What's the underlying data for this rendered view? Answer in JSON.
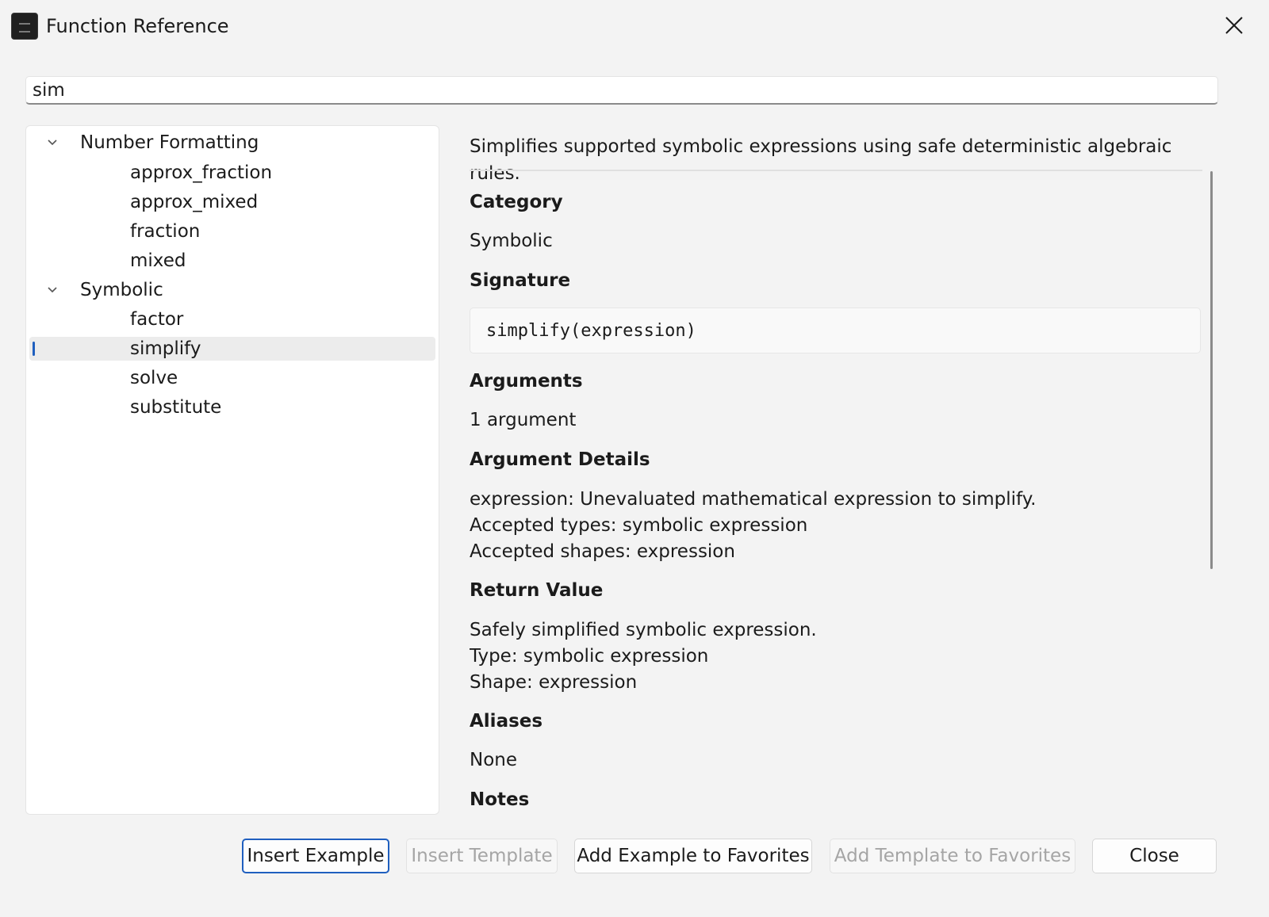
{
  "window": {
    "title": "Function Reference",
    "icon": "calculator-app-icon",
    "close_icon": "close-icon"
  },
  "search": {
    "value": "sim"
  },
  "tree": {
    "groups": [
      {
        "label": "Number Formatting",
        "expanded": true,
        "items": [
          "approx_fraction",
          "approx_mixed",
          "fraction",
          "mixed"
        ]
      },
      {
        "label": "Symbolic",
        "expanded": true,
        "items": [
          "factor",
          "simplify",
          "solve",
          "substitute"
        ]
      }
    ],
    "selected": "simplify",
    "accent_color": "#1f5fbf"
  },
  "details": {
    "description": "Simplifies supported symbolic expressions using safe deterministic algebraic rules.",
    "category_heading": "Category",
    "category": "Symbolic",
    "signature_heading": "Signature",
    "signature": "simplify(expression)",
    "arguments_heading": "Arguments",
    "arguments": "1 argument",
    "argument_details_heading": "Argument Details",
    "argument_details": [
      "expression: Unevaluated mathematical expression to simplify.",
      "Accepted types: symbolic expression",
      "Accepted shapes: expression"
    ],
    "return_heading": "Return Value",
    "return_value": [
      "Safely simplified symbolic expression.",
      "Type: symbolic expression",
      "Shape: expression"
    ],
    "aliases_heading": "Aliases",
    "aliases": "None",
    "notes_heading": "Notes"
  },
  "buttons": {
    "insert_example": "Insert Example",
    "insert_template": "Insert Template",
    "add_example_favorites": "Add Example to Favorites",
    "add_template_favorites": "Add Template to Favorites",
    "close": "Close"
  }
}
